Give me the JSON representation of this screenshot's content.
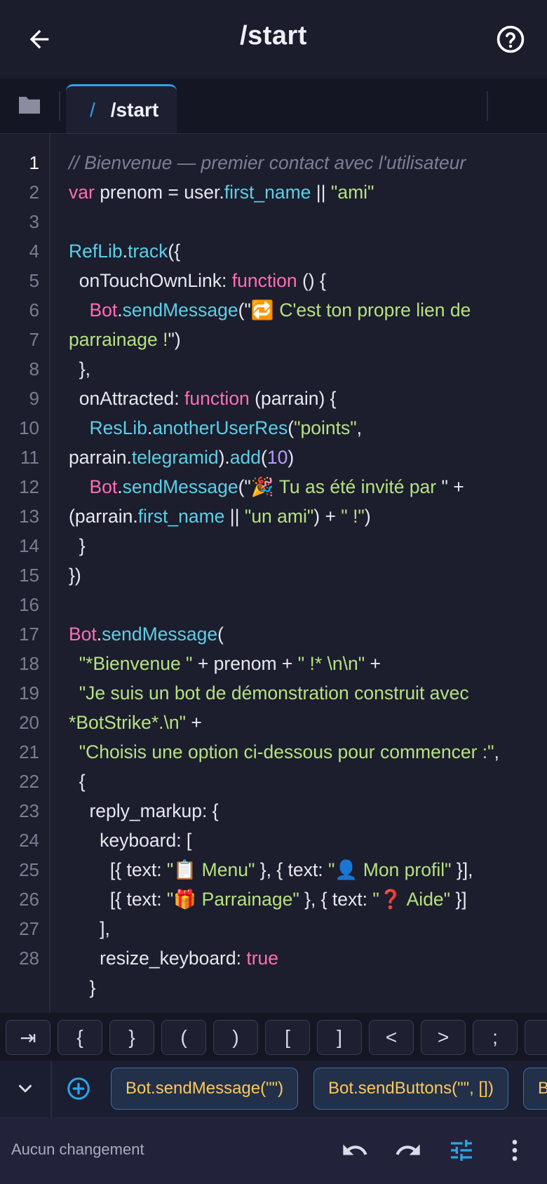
{
  "header": {
    "title": "/start",
    "back_icon": "arrow-left-icon",
    "help_icon": "help-circle-icon"
  },
  "tabs": {
    "folder_icon": "folder-icon",
    "active_tab": {
      "prefix": "/",
      "label": "/start"
    }
  },
  "editor": {
    "active_line": 1,
    "line_numbers": [
      "1",
      "2",
      "3",
      "4",
      "5",
      "6",
      "7",
      "8",
      "9",
      "10",
      "11",
      "12",
      "13",
      "14",
      "15",
      "16",
      "17",
      "18",
      "19",
      "20",
      "21",
      "22",
      "23",
      "24",
      "25",
      "26",
      "27",
      "28"
    ],
    "visual_lines": [
      [
        {
          "t": "// Bienvenue — premier contact avec l'utilisateur",
          "c": "cm"
        }
      ],
      [
        {
          "t": "var",
          "c": "kw"
        },
        {
          "t": " prenom = user."
        },
        {
          "t": "first_name",
          "c": "fn"
        },
        {
          "t": " || "
        },
        {
          "t": "\"ami\"",
          "c": "str"
        }
      ],
      [],
      [
        {
          "t": "RefLib",
          "c": "fn"
        },
        {
          "t": "."
        },
        {
          "t": "track",
          "c": "fn"
        },
        {
          "t": "({"
        }
      ],
      [
        {
          "t": "  onTouchOwnLink: "
        },
        {
          "t": "function",
          "c": "kw"
        },
        {
          "t": " () {"
        }
      ],
      [
        {
          "t": "    "
        },
        {
          "t": "Bot",
          "c": "kw"
        },
        {
          "t": "."
        },
        {
          "t": "sendMessage",
          "c": "fn"
        },
        {
          "t": "(\""
        },
        {
          "t": "🔁 C'est ton propre lien de",
          "c": "str"
        }
      ],
      [
        {
          "t": "parrainage !",
          "c": "str"
        },
        {
          "t": "\")"
        }
      ],
      [
        {
          "t": "  },"
        }
      ],
      [
        {
          "t": "  onAttracted: "
        },
        {
          "t": "function",
          "c": "kw"
        },
        {
          "t": " (parrain) {"
        }
      ],
      [
        {
          "t": "    "
        },
        {
          "t": "ResLib",
          "c": "fn"
        },
        {
          "t": "."
        },
        {
          "t": "anotherUserRes",
          "c": "fn"
        },
        {
          "t": "("
        },
        {
          "t": "\"points\"",
          "c": "str"
        },
        {
          "t": ","
        }
      ],
      [
        {
          "t": "parrain."
        },
        {
          "t": "telegramid",
          "c": "fn"
        },
        {
          "t": ")."
        },
        {
          "t": "add",
          "c": "fn"
        },
        {
          "t": "("
        },
        {
          "t": "10",
          "c": "num"
        },
        {
          "t": ")"
        }
      ],
      [
        {
          "t": "    "
        },
        {
          "t": "Bot",
          "c": "kw"
        },
        {
          "t": "."
        },
        {
          "t": "sendMessage",
          "c": "fn"
        },
        {
          "t": "(\""
        },
        {
          "t": "🎉 Tu as été invité par ",
          "c": "str"
        },
        {
          "t": "\" +"
        }
      ],
      [
        {
          "t": "(parrain."
        },
        {
          "t": "first_name",
          "c": "fn"
        },
        {
          "t": " || "
        },
        {
          "t": "\"un ami\"",
          "c": "str"
        },
        {
          "t": ") + "
        },
        {
          "t": "\" !\"",
          "c": "str"
        },
        {
          "t": ")"
        }
      ],
      [
        {
          "t": "  }"
        }
      ],
      [
        {
          "t": "})"
        }
      ],
      [],
      [
        {
          "t": "Bot",
          "c": "kw"
        },
        {
          "t": "."
        },
        {
          "t": "sendMessage",
          "c": "fn"
        },
        {
          "t": "("
        }
      ],
      [
        {
          "t": "  "
        },
        {
          "t": "\"*Bienvenue \"",
          "c": "str"
        },
        {
          "t": " + prenom + "
        },
        {
          "t": "\" !* \\n\\n\"",
          "c": "str"
        },
        {
          "t": " +"
        }
      ],
      [
        {
          "t": "  "
        },
        {
          "t": "\"Je suis un bot de démonstration construit avec",
          "c": "str"
        }
      ],
      [
        {
          "t": "*BotStrike*.\\n\"",
          "c": "str"
        },
        {
          "t": " +"
        }
      ],
      [
        {
          "t": "  "
        },
        {
          "t": "\"Choisis une option ci-dessous pour commencer :\"",
          "c": "str"
        },
        {
          "t": ","
        }
      ],
      [
        {
          "t": "  {"
        }
      ],
      [
        {
          "t": "    reply_markup: {"
        }
      ],
      [
        {
          "t": "      keyboard: ["
        }
      ],
      [
        {
          "t": "        [{ text: "
        },
        {
          "t": "\"📋 Menu\"",
          "c": "str"
        },
        {
          "t": " }, { text: "
        },
        {
          "t": "\"👤 Mon profil\"",
          "c": "str"
        },
        {
          "t": " }],"
        }
      ],
      [
        {
          "t": "        [{ text: "
        },
        {
          "t": "\"🎁 Parrainage\"",
          "c": "str"
        },
        {
          "t": " }, { text: "
        },
        {
          "t": "\"❓ Aide\"",
          "c": "str"
        },
        {
          "t": " }]"
        }
      ],
      [
        {
          "t": "      ],"
        }
      ],
      [
        {
          "t": "      resize_keyboard: "
        },
        {
          "t": "true",
          "c": "kw"
        }
      ],
      [
        {
          "t": "    }"
        }
      ]
    ]
  },
  "symbols": [
    "⇥",
    "{",
    "}",
    "(",
    ")",
    "[",
    "]",
    "<",
    ">",
    ";",
    ""
  ],
  "snippets": {
    "chevron_icon": "chevron-down-icon",
    "add_icon": "plus-circle-icon",
    "items": [
      "Bot.sendMessage(\"\")",
      "Bot.sendButtons(\"\", [])",
      "B"
    ]
  },
  "footer": {
    "status": "Aucun changement",
    "undo_icon": "undo-icon",
    "redo_icon": "redo-icon",
    "settings_icon": "tune-icon",
    "more_icon": "more-vert-icon"
  },
  "colors": {
    "accent": "#2ba4ea",
    "keyword": "#ff6eb4",
    "function": "#5ccfe6",
    "string": "#b5e280",
    "comment": "#7c8096",
    "number": "#b39dfc",
    "chip_text": "#ffc857"
  }
}
